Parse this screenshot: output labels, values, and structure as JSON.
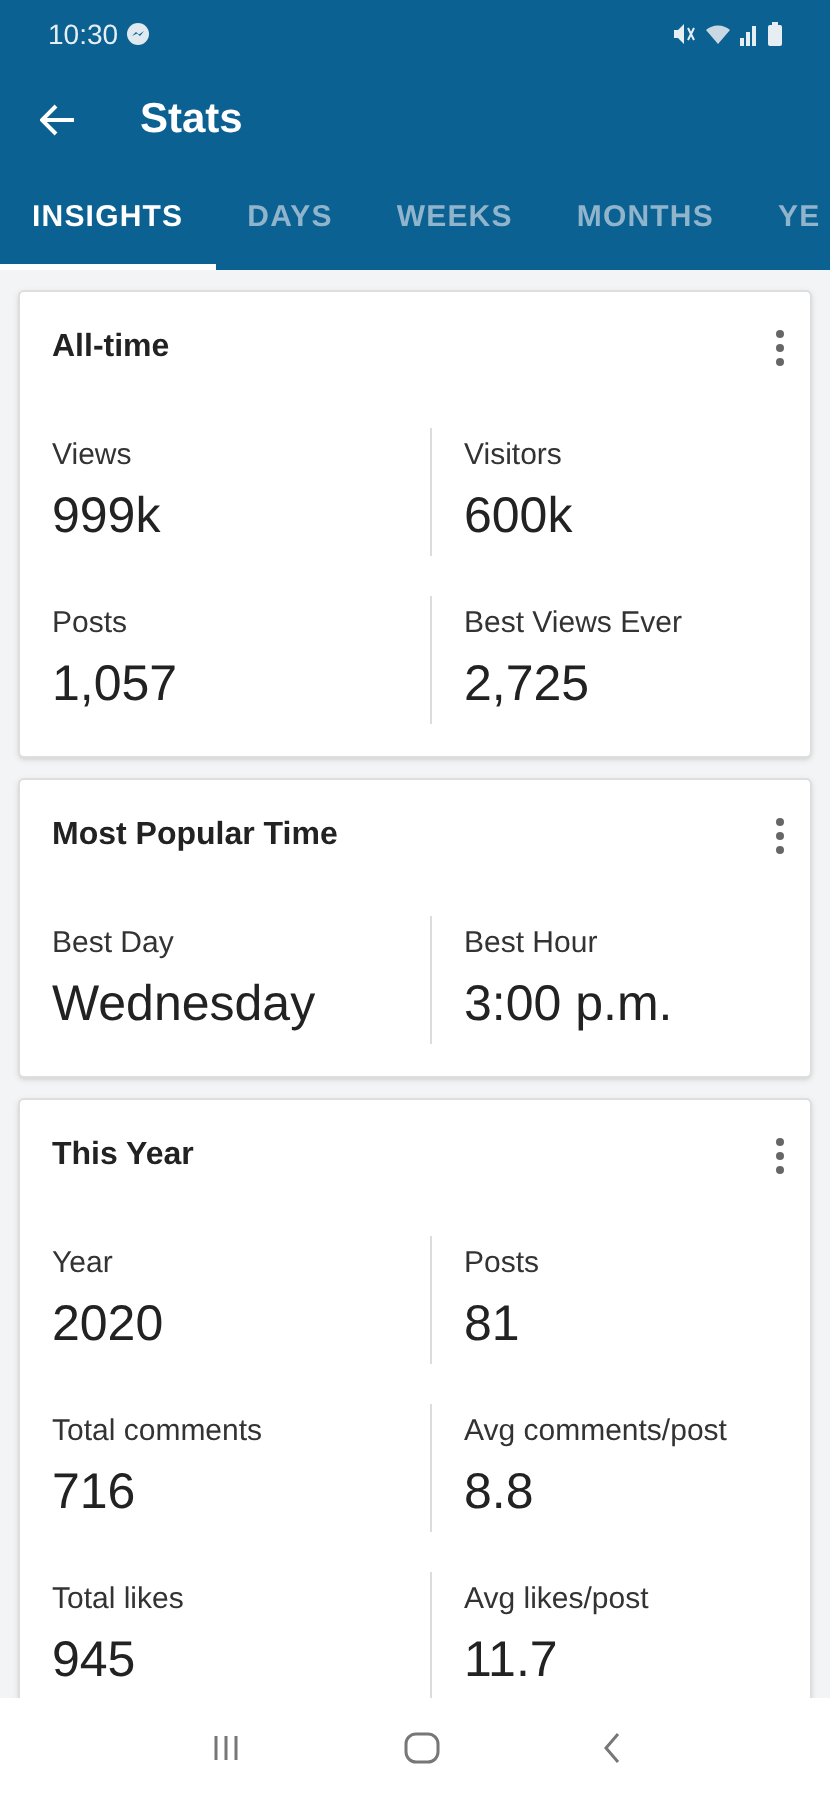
{
  "status_bar": {
    "time": "10:30"
  },
  "app_bar": {
    "title": "Stats"
  },
  "tabs": [
    {
      "label": "INSIGHTS",
      "selected": true
    },
    {
      "label": "DAYS",
      "selected": false
    },
    {
      "label": "WEEKS",
      "selected": false
    },
    {
      "label": "MONTHS",
      "selected": false
    },
    {
      "label": "YE",
      "selected": false
    }
  ],
  "cards": [
    {
      "title": "All-time",
      "rows": [
        [
          {
            "label": "Views",
            "value": "999k"
          },
          {
            "label": "Visitors",
            "value": "600k"
          }
        ],
        [
          {
            "label": "Posts",
            "value": "1,057"
          },
          {
            "label": "Best Views Ever",
            "value": "2,725"
          }
        ]
      ]
    },
    {
      "title": "Most Popular Time",
      "rows": [
        [
          {
            "label": "Best Day",
            "value": "Wednesday"
          },
          {
            "label": "Best Hour",
            "value": "3:00 p.m."
          }
        ]
      ]
    },
    {
      "title": "This Year",
      "rows": [
        [
          {
            "label": "Year",
            "value": "2020"
          },
          {
            "label": "Posts",
            "value": "81"
          }
        ],
        [
          {
            "label": "Total comments",
            "value": "716"
          },
          {
            "label": "Avg comments/post",
            "value": "8.8"
          }
        ],
        [
          {
            "label": "Total likes",
            "value": "945"
          },
          {
            "label": "Avg likes/post",
            "value": "11.7"
          }
        ]
      ]
    }
  ]
}
